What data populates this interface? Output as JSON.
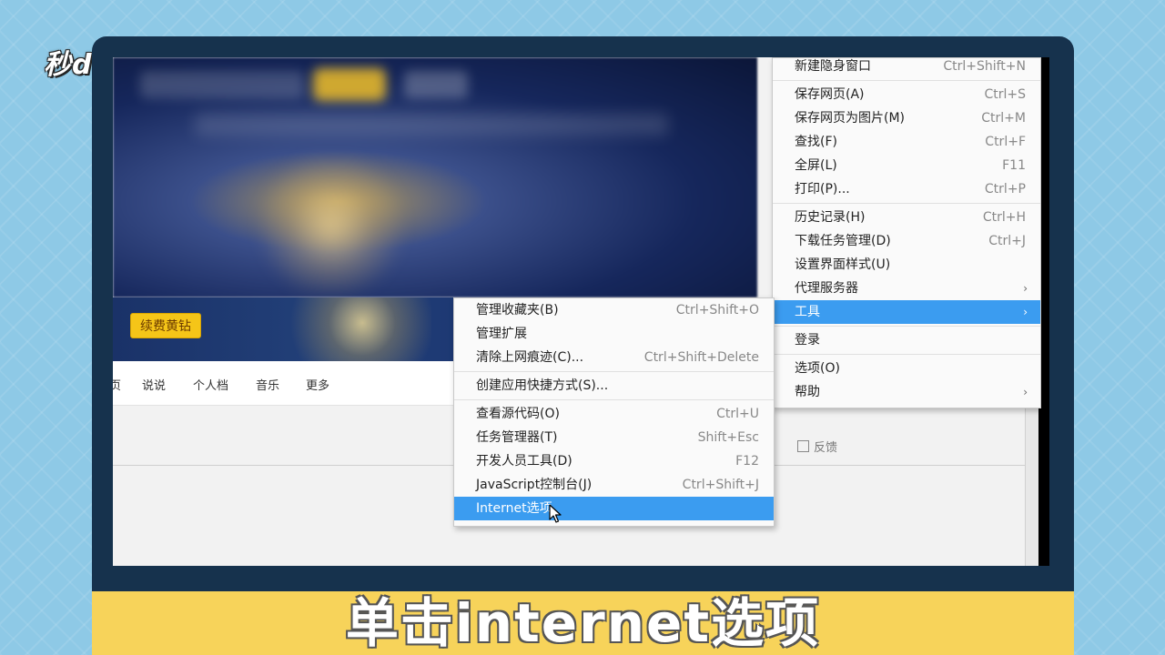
{
  "watermark": "秒dong视频",
  "page": {
    "vip_button": "续费黄钻",
    "nav_items": [
      "说说",
      "个人档",
      "音乐",
      "更多"
    ],
    "nav_partial": "页",
    "feedback": "反馈"
  },
  "main_menu": {
    "items": [
      {
        "label": "新建隐身窗口",
        "shortcut": "Ctrl+Shift+N"
      },
      {
        "label": "保存网页(A)",
        "shortcut": "Ctrl+S"
      },
      {
        "label": "保存网页为图片(M)",
        "shortcut": "Ctrl+M"
      },
      {
        "label": "查找(F)",
        "shortcut": "Ctrl+F"
      },
      {
        "label": "全屏(L)",
        "shortcut": "F11"
      },
      {
        "label": "打印(P)...",
        "shortcut": "Ctrl+P"
      },
      {
        "label": "历史记录(H)",
        "shortcut": "Ctrl+H"
      },
      {
        "label": "下载任务管理(D)",
        "shortcut": "Ctrl+J"
      },
      {
        "label": "设置界面样式(U)",
        "shortcut": ""
      },
      {
        "label": "代理服务器",
        "shortcut": ""
      },
      {
        "label": "工具",
        "shortcut": ""
      },
      {
        "label": "登录",
        "shortcut": ""
      },
      {
        "label": "选项(O)",
        "shortcut": ""
      },
      {
        "label": "帮助",
        "shortcut": ""
      }
    ],
    "submenu_arrow": "›"
  },
  "tools_submenu": {
    "items": [
      {
        "label": "管理收藏夹(B)",
        "shortcut": "Ctrl+Shift+O"
      },
      {
        "label": "管理扩展",
        "shortcut": ""
      },
      {
        "label": "清除上网痕迹(C)...",
        "shortcut": "Ctrl+Shift+Delete"
      },
      {
        "label": "创建应用快捷方式(S)...",
        "shortcut": ""
      },
      {
        "label": "查看源代码(O)",
        "shortcut": "Ctrl+U"
      },
      {
        "label": "任务管理器(T)",
        "shortcut": "Shift+Esc"
      },
      {
        "label": "开发人员工具(D)",
        "shortcut": "F12"
      },
      {
        "label": "JavaScript控制台(J)",
        "shortcut": "Ctrl+Shift+J"
      },
      {
        "label": "Internet选项",
        "shortcut": ""
      }
    ]
  },
  "caption": "单击internet选项",
  "colors": {
    "highlight": "#3b9cf0",
    "caption_bar": "#f7d35a",
    "monitor": "#16324d",
    "background": "#8ec9e6"
  }
}
